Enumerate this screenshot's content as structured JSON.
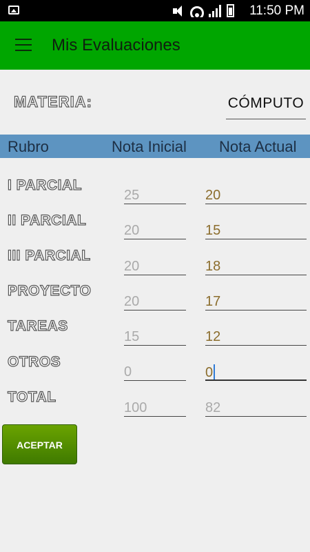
{
  "status_bar": {
    "time": "11:50 PM"
  },
  "app": {
    "title": "Mis Evaluaciones"
  },
  "materia": {
    "label": "MATERIA:",
    "value": "CÓMPUTO"
  },
  "table": {
    "headers": [
      "Rubro",
      "Nota Inicial",
      "Nota Actual"
    ],
    "rows": [
      {
        "rubro": "I PARCIAL",
        "inicial": "25",
        "actual": "20"
      },
      {
        "rubro": "II PARCIAL",
        "inicial": "20",
        "actual": "15"
      },
      {
        "rubro": "III PARCIAL",
        "inicial": "20",
        "actual": "18"
      },
      {
        "rubro": "PROYECTO",
        "inicial": "20",
        "actual": "17"
      },
      {
        "rubro": "TAREAS",
        "inicial": "15",
        "actual": "12"
      },
      {
        "rubro": "OTROS",
        "inicial": "0",
        "actual": "0"
      },
      {
        "rubro": "TOTAL",
        "inicial": "100",
        "actual": "82"
      }
    ]
  },
  "actions": {
    "accept_label": "ACEPTAR"
  },
  "colors": {
    "appbar": "#00a600",
    "header": "#5d94c1",
    "button": "#4f8a00"
  }
}
